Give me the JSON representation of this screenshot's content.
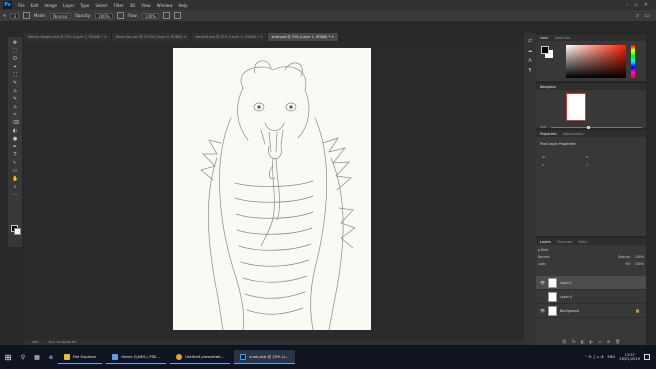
{
  "menu": {
    "logo": "Ps",
    "items": [
      "File",
      "Edit",
      "Image",
      "Layer",
      "Type",
      "Select",
      "Filter",
      "3D",
      "View",
      "Window",
      "Help"
    ],
    "window_controls": [
      "–",
      "▫",
      "✕"
    ]
  },
  "options": {
    "brush_size": "3",
    "mode_label": "Mode:",
    "mode_value": "Normal",
    "opacity_label": "Opacity:",
    "opacity_value": "100%",
    "flow_label": "Flow:",
    "flow_value": "100%",
    "right_icons": [
      "⌕",
      "▭"
    ]
  },
  "tabs": [
    {
      "label": "demon dragon.psd @ 25% (Layer 1, RGB/8) * ✕",
      "active": false
    },
    {
      "label": "Seals lion.psd @ 33.3% (Layer 2, RGB/8) ✕",
      "active": false
    },
    {
      "label": "serpent.psd @ 25% (Layer 1, RGB/8) * ✕",
      "active": false
    },
    {
      "label": "snek.psd @ 25% (Layer 1, RGB/8) * ✕",
      "active": true
    }
  ],
  "tools": [
    "✥",
    "⬚",
    "ʘ",
    "⌖",
    "⛶",
    "✎",
    "⌂",
    "✎",
    "⌂",
    "✑",
    "⌫",
    "◐",
    "●",
    "✒",
    "T",
    "↖",
    "▭",
    "✋",
    "⌕",
    "⋯"
  ],
  "status": {
    "zoom": "25%",
    "doc": "Doc: 24.9M/36.3M"
  },
  "mini_icons": [
    "⇄",
    "☁",
    "A",
    "¶"
  ],
  "color_panel": {
    "tabs": [
      "Color",
      "Swatches"
    ],
    "active_tab": "Color"
  },
  "navigator": {
    "tab": "Navigator",
    "zoom": "25%",
    "zoom_level": 0.4
  },
  "properties": {
    "tabs": [
      "Properties",
      "Adjustments"
    ],
    "title": "Pixel Layer Properties",
    "w_label": "W:",
    "w_value": "",
    "h_label": "H:",
    "h_value": "",
    "x_label": "X:",
    "x_value": "",
    "y_label": "Y:",
    "y_value": ""
  },
  "layers_panel": {
    "tabs": [
      "Layers",
      "Channels",
      "Paths"
    ],
    "kind_label": "ρ Kind",
    "blend_mode": "Normal",
    "opacity_label": "Opacity:",
    "opacity_value": "100%",
    "lock_label": "Lock:",
    "fill_label": "Fill:",
    "fill_value": "100%",
    "layers": [
      {
        "name": "Layer 1",
        "visible": true,
        "selected": true
      },
      {
        "name": "Layer 0",
        "visible": false,
        "selected": false
      },
      {
        "name": "Background",
        "visible": true,
        "selected": false,
        "locked": true
      }
    ],
    "bottom_icons": [
      "⛓",
      "fx",
      "◧",
      "◐",
      "▭",
      "⊞",
      "🗑"
    ]
  },
  "taskbar": {
    "start": "⊞",
    "icons": [
      "⚲",
      "▦",
      "e"
    ],
    "apps": [
      {
        "label": "File Explorer",
        "color": "#e8b84a",
        "active": false
      },
      {
        "label": "Home (\\\\NES-\\ PSE...",
        "color": "#5aa0e0",
        "active": false
      },
      {
        "label": "Untitled presentati...",
        "color": "#e8a040",
        "active": false
      },
      {
        "label": "snek.psd @ 25% (L...",
        "color": "#31a8ff",
        "active": true
      }
    ],
    "tray_lang": "ENG",
    "time": "13:37",
    "date": "26/01/2019"
  }
}
